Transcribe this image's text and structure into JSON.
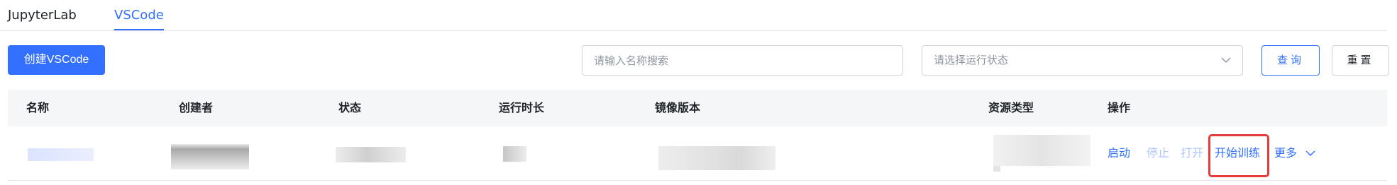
{
  "tabs": [
    {
      "label": "JupyterLab",
      "active": false
    },
    {
      "label": "VSCode",
      "active": true
    }
  ],
  "toolbar": {
    "create_label": "创建VSCode",
    "search_placeholder": "请输入名称搜索",
    "status_placeholder": "请选择运行状态",
    "query_label": "查询",
    "reset_label": "重置"
  },
  "table": {
    "columns": [
      "名称",
      "创建者",
      "状态",
      "运行时长",
      "镜像版本",
      "资源类型",
      "操作"
    ],
    "rows": [
      {
        "actions": {
          "start": "启动",
          "stop": "停止",
          "open": "打开",
          "train": "开始训练",
          "more": "更多"
        }
      }
    ]
  },
  "colors": {
    "accent": "#3370ff",
    "disabled_link": "#adc6ff",
    "highlight": "#e63b3b"
  },
  "icons": {
    "select_arrow": "chevron-down-icon",
    "more_arrow": "chevron-down-icon"
  }
}
